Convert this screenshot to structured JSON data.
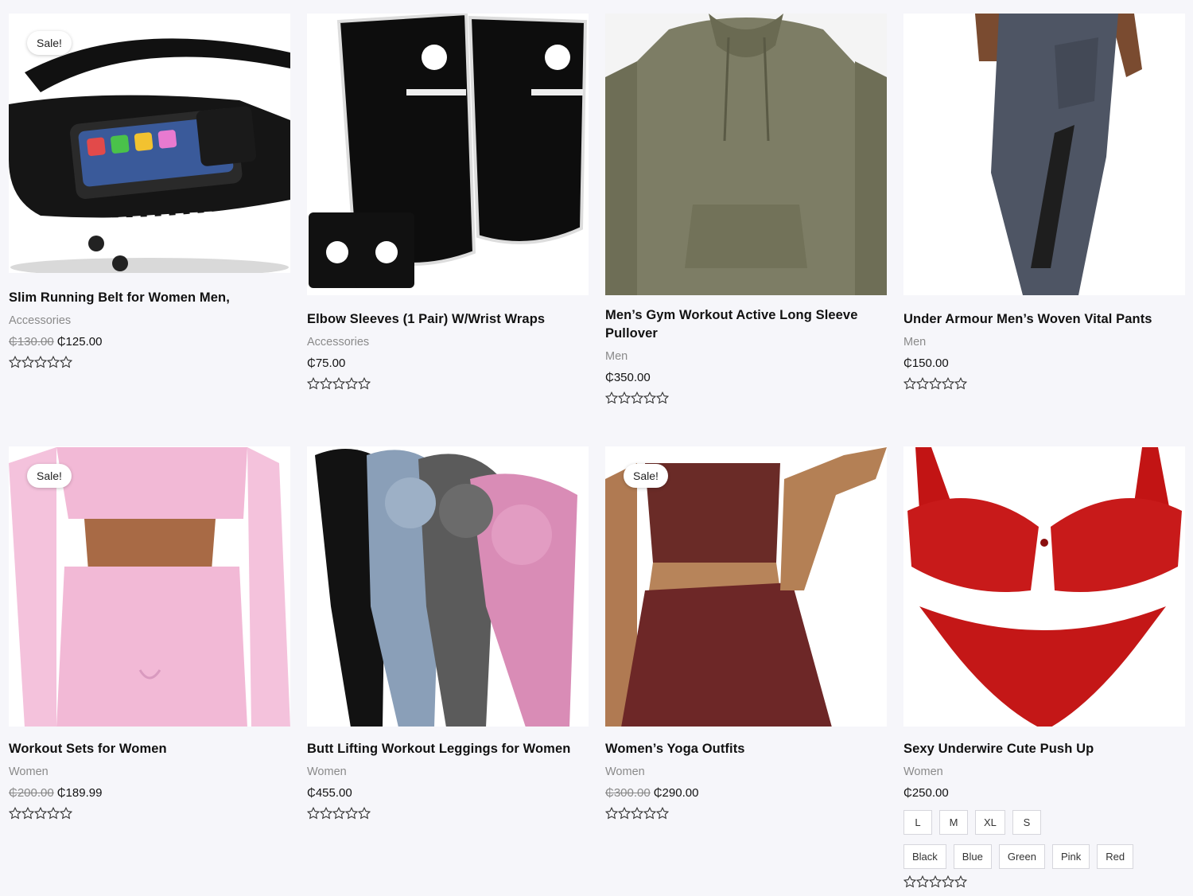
{
  "sale_badge": "Sale!",
  "currency_symbol": "₵",
  "products": [
    {
      "title": "Slim Running Belt for Women Men,",
      "category": "Accessories",
      "old_price": "₵130.00",
      "price": "₵125.00",
      "on_sale": true,
      "rating": 0
    },
    {
      "title": "Elbow Sleeves (1 Pair) W/Wrist Wraps",
      "category": "Accessories",
      "old_price": "",
      "price": "₵75.00",
      "on_sale": false,
      "rating": 0
    },
    {
      "title": "Men’s Gym Workout Active Long Sleeve Pullover",
      "category": "Men",
      "old_price": "",
      "price": "₵350.00",
      "on_sale": false,
      "rating": 0
    },
    {
      "title": "Under Armour Men’s Woven Vital Pants",
      "category": "Men",
      "old_price": "",
      "price": "₵150.00",
      "on_sale": false,
      "rating": 0
    },
    {
      "title": "Workout Sets for Women",
      "category": "Women",
      "old_price": "₵200.00",
      "price": "₵189.99",
      "on_sale": true,
      "rating": 0
    },
    {
      "title": "Butt Lifting Workout Leggings for Women",
      "category": "Women",
      "old_price": "",
      "price": "₵455.00",
      "on_sale": false,
      "rating": 0
    },
    {
      "title": "Women’s Yoga Outfits",
      "category": "Women",
      "old_price": "₵300.00",
      "price": "₵290.00",
      "on_sale": true,
      "rating": 0
    },
    {
      "title": "Sexy Underwire Cute Push Up",
      "category": "Women",
      "old_price": "",
      "price": "₵250.00",
      "on_sale": false,
      "rating": 0,
      "sizes": [
        "L",
        "M",
        "XL",
        "S"
      ],
      "colors": [
        "Black",
        "Blue",
        "Green",
        "Pink",
        "Red"
      ]
    }
  ],
  "colors": {
    "background": "#f6f6fa",
    "card_image_bg": "#ffffff",
    "title": "#111111",
    "category": "#8a8a8a",
    "star_outline": "#333333"
  }
}
